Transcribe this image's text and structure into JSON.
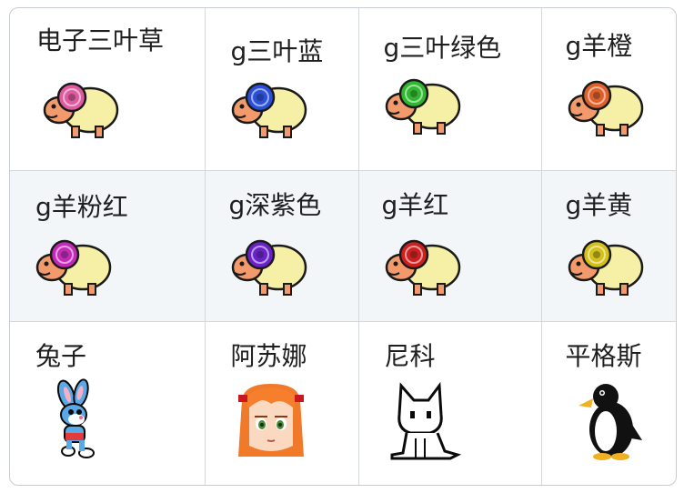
{
  "cells": [
    {
      "name": "电子三叶草",
      "horn_color": "#e05aa0"
    },
    {
      "name": "g三叶蓝",
      "horn_color": "#2a4fd8"
    },
    {
      "name": "g三叶绿色",
      "horn_color": "#2fb82f"
    },
    {
      "name": "g羊橙",
      "horn_color": "#e0602a"
    },
    {
      "name": "g羊粉红",
      "horn_color": "#c42ab8"
    },
    {
      "name": "g深紫色",
      "horn_color": "#6a22c8"
    },
    {
      "name": "g羊红",
      "horn_color": "#cc1f1f"
    },
    {
      "name": "g羊黄",
      "horn_color": "#d4c01a"
    },
    {
      "name": "兔子"
    },
    {
      "name": "阿苏娜"
    },
    {
      "name": "尼科"
    },
    {
      "name": "平格斯"
    }
  ]
}
